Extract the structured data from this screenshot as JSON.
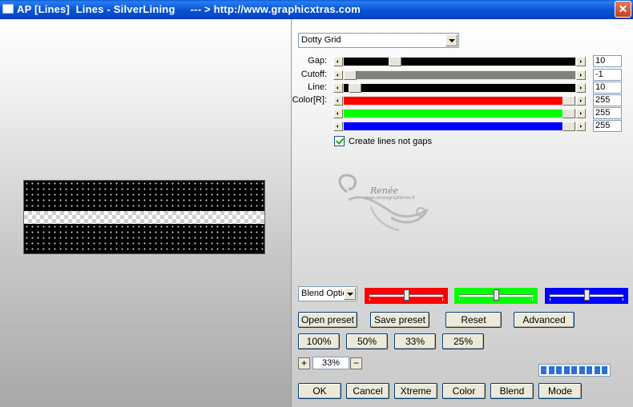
{
  "window": {
    "title": "AP [Lines]  Lines - SilverLining     --- > http://www.graphicxtras.com",
    "close_glyph": "✕"
  },
  "preset_dropdown": {
    "value": "Dotty Grid"
  },
  "params": [
    {
      "label": "Gap:",
      "value": "10",
      "fraction": 0.22,
      "fill": "#000000"
    },
    {
      "label": "Cutoff:",
      "value": "-1",
      "fraction": 0.02,
      "fill": "#808080"
    },
    {
      "label": "Line:",
      "value": "10",
      "fraction": 0.05,
      "fill": "#000000"
    },
    {
      "label": "Color[R]:",
      "value": "255",
      "fraction": 1.0,
      "fill": "#ff0000"
    },
    {
      "label": "",
      "value": "255",
      "fraction": 1.0,
      "fill": "#00ff00"
    },
    {
      "label": "",
      "value": "255",
      "fraction": 1.0,
      "fill": "#0000ff"
    }
  ],
  "create_lines_checkbox": {
    "label": "Create lines not gaps",
    "checked": true
  },
  "blend_dropdown": {
    "value": "Blend Optio"
  },
  "color_sliders": [
    {
      "name": "red",
      "color": "#ff0000",
      "level": 0.5
    },
    {
      "name": "green",
      "color": "#00ff00",
      "level": 0.5
    },
    {
      "name": "blue",
      "color": "#0000ff",
      "level": 0.5
    }
  ],
  "buttons": {
    "open_preset": "Open preset",
    "save_preset": "Save preset",
    "reset": "Reset",
    "advanced": "Advanced",
    "zoom_100": "100%",
    "zoom_50": "50%",
    "zoom_33": "33%",
    "zoom_25": "25%",
    "plus": "+",
    "minus": "−",
    "ok": "OK",
    "cancel": "Cancel",
    "xtreme": "Xtreme",
    "color": "Color",
    "blend": "Blend",
    "mode": "Mode"
  },
  "zoom_field": {
    "value": "33%"
  },
  "progress": {
    "segments": 9
  },
  "watermark": {
    "text": "Renée",
    "subtext": "www.reneegraphisme.fr"
  },
  "colors": {
    "titlebar": "#0855d6",
    "slider_black": "#000000",
    "slider_gray": "#808080"
  }
}
